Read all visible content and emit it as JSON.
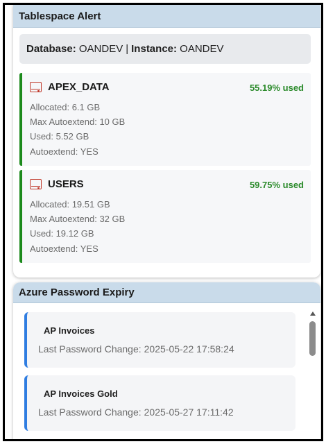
{
  "tablespace": {
    "title": "Tablespace Alert",
    "database_label": "Database:",
    "database_value": "OANDEV",
    "separator": "|",
    "instance_label": "Instance:",
    "instance_value": "OANDEV",
    "tablespaces": [
      {
        "icon": "disk-icon",
        "name": "APEX_DATA",
        "used_pct": "55.19% used",
        "allocated": "Allocated: 6.1 GB",
        "max_autoextend": "Max Autoextend: 10 GB",
        "used": "Used: 5.52 GB",
        "autoextend": "Autoextend: YES"
      },
      {
        "icon": "disk-icon",
        "name": "USERS",
        "used_pct": "59.75% used",
        "allocated": "Allocated: 19.51 GB",
        "max_autoextend": "Max Autoextend: 32 GB",
        "used": "Used: 19.12 GB",
        "autoextend": "Autoextend: YES"
      }
    ]
  },
  "azure": {
    "title": "Azure Password Expiry",
    "items": [
      {
        "name": "AP Invoices",
        "label": "Last Password Change:",
        "value": "2025-05-22 17:58:24"
      },
      {
        "name": "AP Invoices Gold",
        "label": "Last Password Change:",
        "value": "2025-05-27 17:11:42"
      }
    ]
  },
  "colors": {
    "header_bg": "#c9dbea",
    "ok_green": "#1c8a1c",
    "accent_blue": "#2f7de1",
    "icon_red": "#c0392b"
  }
}
